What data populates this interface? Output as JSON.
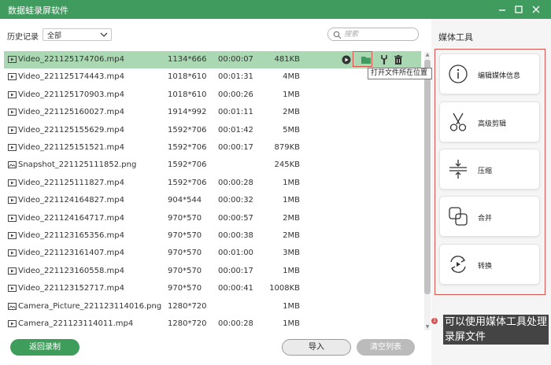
{
  "window": {
    "title": "数据蛙录屏软件",
    "controls": [
      "minimize",
      "maximize",
      "close"
    ]
  },
  "filter": {
    "label": "历史记录",
    "selected": "全部"
  },
  "search": {
    "placeholder": "搜索"
  },
  "files": [
    {
      "name": "Video_221125174706.mp4",
      "resolution": "1134*666",
      "duration": "00:00:07",
      "size": "481KB",
      "type": "video",
      "selected": true
    },
    {
      "name": "Video_221125174443.mp4",
      "resolution": "1018*610",
      "duration": "00:01:31",
      "size": "4MB",
      "type": "video"
    },
    {
      "name": "Video_221125170903.mp4",
      "resolution": "1018*610",
      "duration": "00:00:26",
      "size": "1MB",
      "type": "video"
    },
    {
      "name": "Video_221125160027.mp4",
      "resolution": "1914*992",
      "duration": "00:01:11",
      "size": "2MB",
      "type": "video"
    },
    {
      "name": "Video_221125155629.mp4",
      "resolution": "1592*706",
      "duration": "00:01:42",
      "size": "5MB",
      "type": "video"
    },
    {
      "name": "Video_221125151521.mp4",
      "resolution": "1592*706",
      "duration": "00:00:17",
      "size": "879KB",
      "type": "video"
    },
    {
      "name": "Snapshot_221125111852.png",
      "resolution": "1592*706",
      "duration": "",
      "size": "245KB",
      "type": "image"
    },
    {
      "name": "Video_221125111827.mp4",
      "resolution": "1592*706",
      "duration": "00:00:28",
      "size": "1MB",
      "type": "video"
    },
    {
      "name": "Video_221124164827.mp4",
      "resolution": "904*544",
      "duration": "00:00:32",
      "size": "1MB",
      "type": "video"
    },
    {
      "name": "Video_221124164717.mp4",
      "resolution": "970*570",
      "duration": "00:00:57",
      "size": "2MB",
      "type": "video"
    },
    {
      "name": "Video_221123165356.mp4",
      "resolution": "970*570",
      "duration": "00:00:38",
      "size": "2MB",
      "type": "video"
    },
    {
      "name": "Video_221123161407.mp4",
      "resolution": "970*570",
      "duration": "00:01:00",
      "size": "3MB",
      "type": "video"
    },
    {
      "name": "Video_221123160558.mp4",
      "resolution": "970*570",
      "duration": "00:00:17",
      "size": "1MB",
      "type": "video"
    },
    {
      "name": "Video_221123152717.mp4",
      "resolution": "970*570",
      "duration": "00:00:41",
      "size": "1008KB",
      "type": "video"
    },
    {
      "name": "Camera_Picture_221123114016.png",
      "resolution": "1280*720",
      "duration": "",
      "size": "1MB",
      "type": "image"
    },
    {
      "name": "Camera_221123114011.mp4",
      "resolution": "1280*720",
      "duration": "00:00:28",
      "size": "1MB",
      "type": "video"
    }
  ],
  "row_actions": [
    "play-icon",
    "folder-icon",
    "tools-icon",
    "trash-icon"
  ],
  "tooltip": "打开文件所在位置",
  "media_tools": {
    "title": "媒体工具",
    "items": [
      {
        "label": "编辑媒体信息",
        "icon": "info-icon"
      },
      {
        "label": "高级剪辑",
        "icon": "scissors-icon"
      },
      {
        "label": "压缩",
        "icon": "compress-icon"
      },
      {
        "label": "合并",
        "icon": "merge-icon"
      },
      {
        "label": "转换",
        "icon": "convert-icon"
      }
    ]
  },
  "annotation": {
    "badge": "1",
    "text": "可以使用媒体工具处理录屏文件"
  },
  "buttons": {
    "back": "返回录制",
    "import": "导入",
    "clear": "清空列表"
  },
  "colors": {
    "brand_green": "#3f9b5e",
    "selected_row": "#a9d8b2",
    "highlight_red": "#d9534f"
  }
}
